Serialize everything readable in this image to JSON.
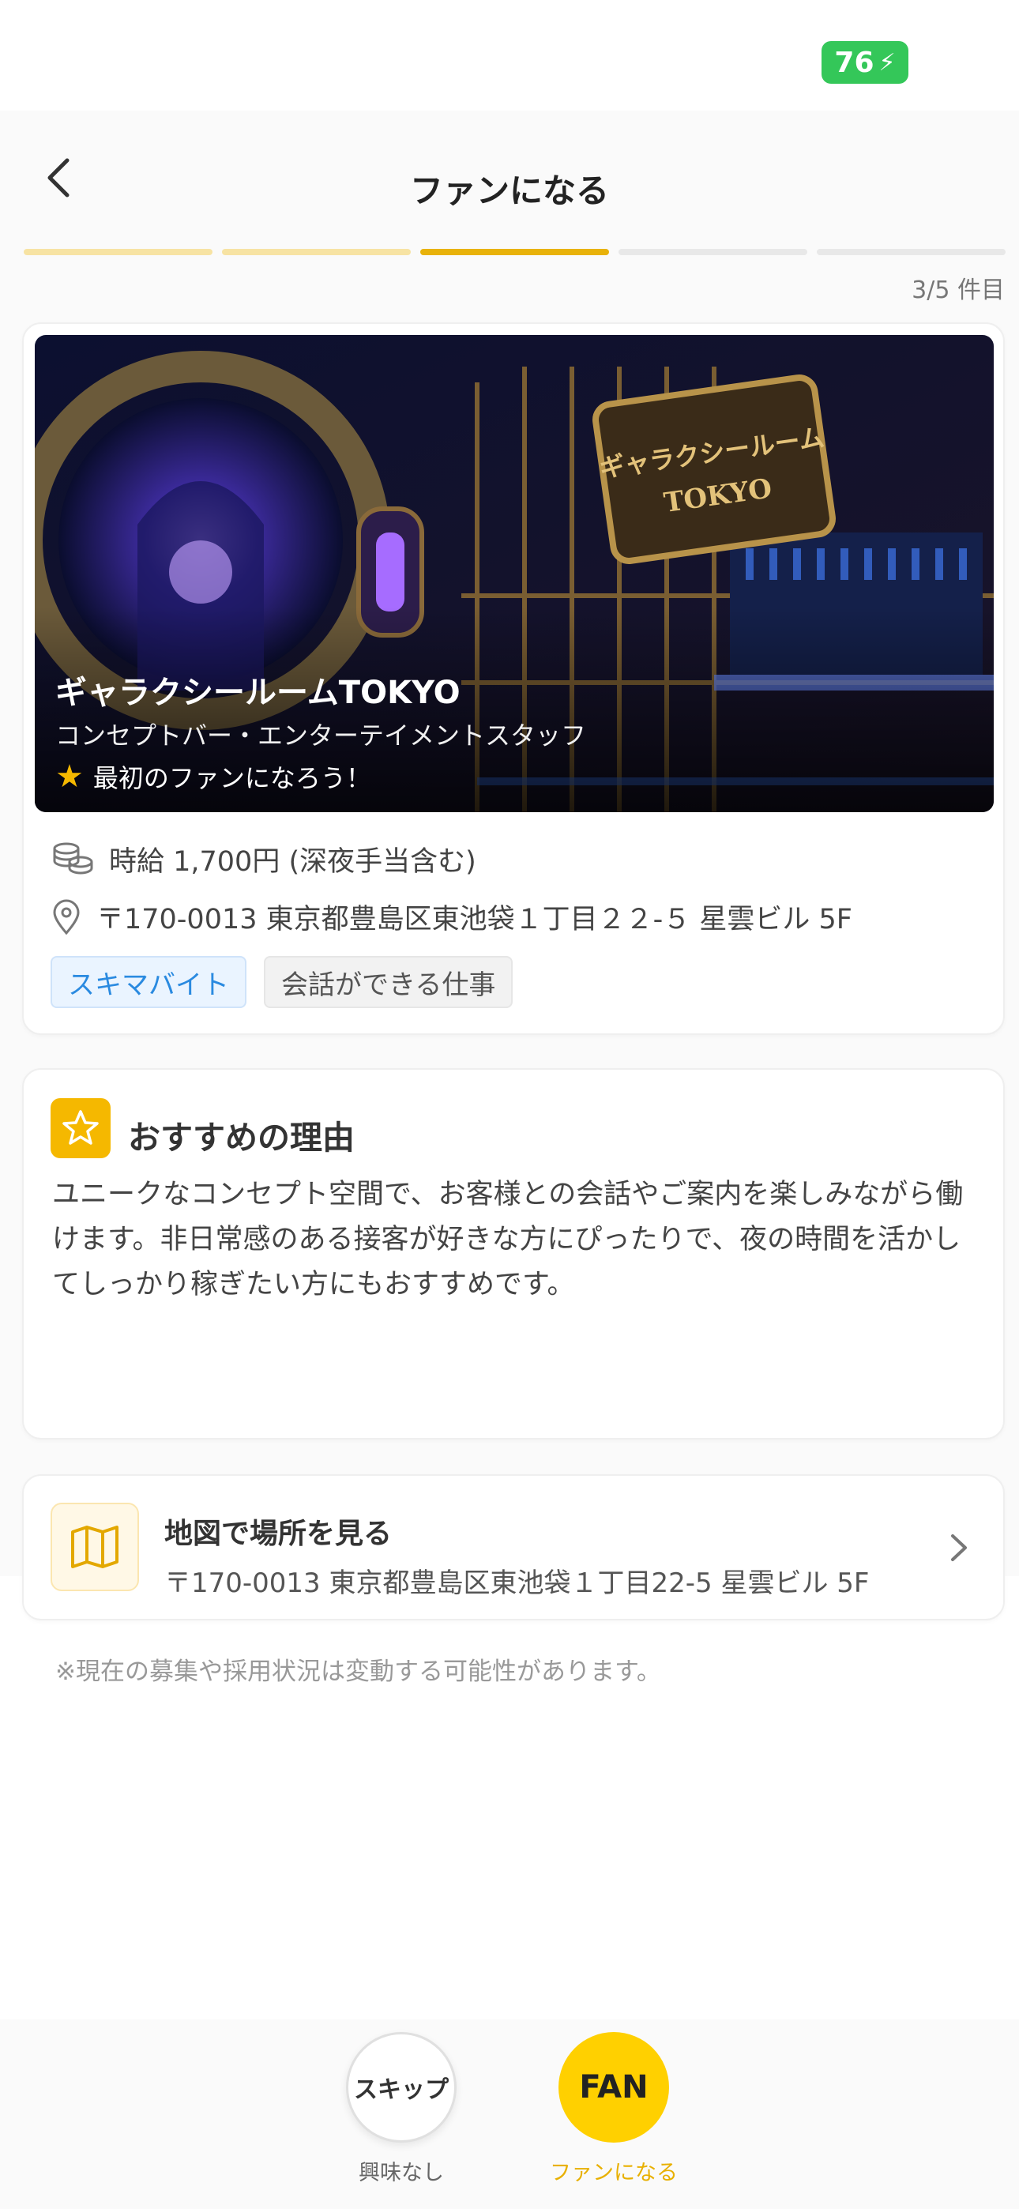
{
  "status_bar": {
    "battery_level": "76"
  },
  "header": {
    "title": "ファンになる"
  },
  "progress": {
    "current": 3,
    "total": 5,
    "counter_text": "3/5 件目",
    "colors": {
      "done": "#f7e3a3",
      "current": "#e8b20a",
      "todo": "#e8e8e8"
    }
  },
  "job": {
    "name": "ギャラクシールームTOKYO",
    "role": "コンセプトバー・エンターテイメントスタッフ",
    "fan_prompt": "最初のファンになろう！",
    "wage": "時給 1,700円 (深夜手当含む)",
    "address": "〒170-0013 東京都豊島区東池袋１丁目２２-５ 星雲ビル 5F",
    "tags": [
      "スキマバイト",
      "会話ができる仕事"
    ],
    "hero_sign": [
      "ギャラクシールーム",
      "TOKYO"
    ]
  },
  "reason": {
    "title": "おすすめの理由",
    "body": "ユニークなコンセプト空間で、お客様との会話やご案内を楽しみながら働けます。非日常感のある接客が好きな方にぴったりで、夜の時間を活かしてしっかり稼ぎたい方にもおすすめです。"
  },
  "map": {
    "title": "地図で場所を見る",
    "address": "〒170-0013 東京都豊島区東池袋１丁目22-5 星雲ビル 5F"
  },
  "note": "※現在の募集や採用状況は変動する可能性があります。",
  "actions": {
    "skip_button": "スキップ",
    "skip_label": "興味なし",
    "fan_button": "FAN",
    "fan_label": "ファンになる"
  },
  "colors": {
    "accent": "#ffd000",
    "tag_blue": "#2a8ae0",
    "battery": "#34c759"
  }
}
